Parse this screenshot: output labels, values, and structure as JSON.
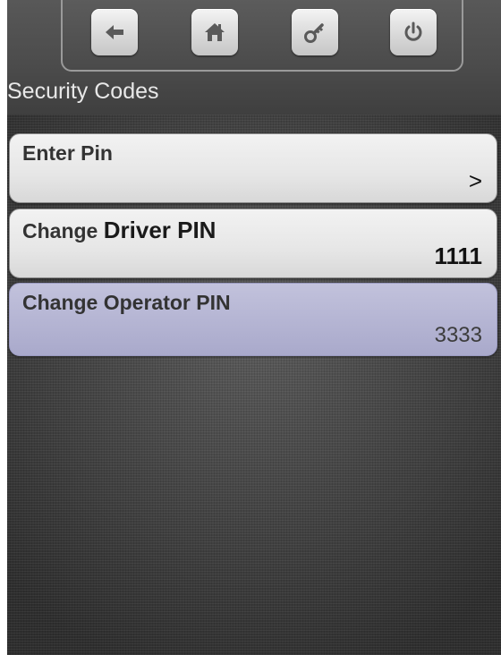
{
  "toolbar": {
    "buttons": [
      {
        "icon": "back-arrow-icon"
      },
      {
        "icon": "home-icon"
      },
      {
        "icon": "key-icon"
      },
      {
        "icon": "power-icon"
      }
    ]
  },
  "page": {
    "title": "Security Codes"
  },
  "menu": {
    "enter_pin": {
      "label": "Enter Pin",
      "chevron": ">"
    },
    "driver": {
      "label_prefix": "Change",
      "label_main": "Driver PIN",
      "value": "1111"
    },
    "operator": {
      "label": "Change Operator PIN",
      "value": "3333"
    }
  },
  "colors": {
    "selected_item": "#b3b3d2",
    "item_bg": "#e6e6e6",
    "background": "#474747"
  }
}
